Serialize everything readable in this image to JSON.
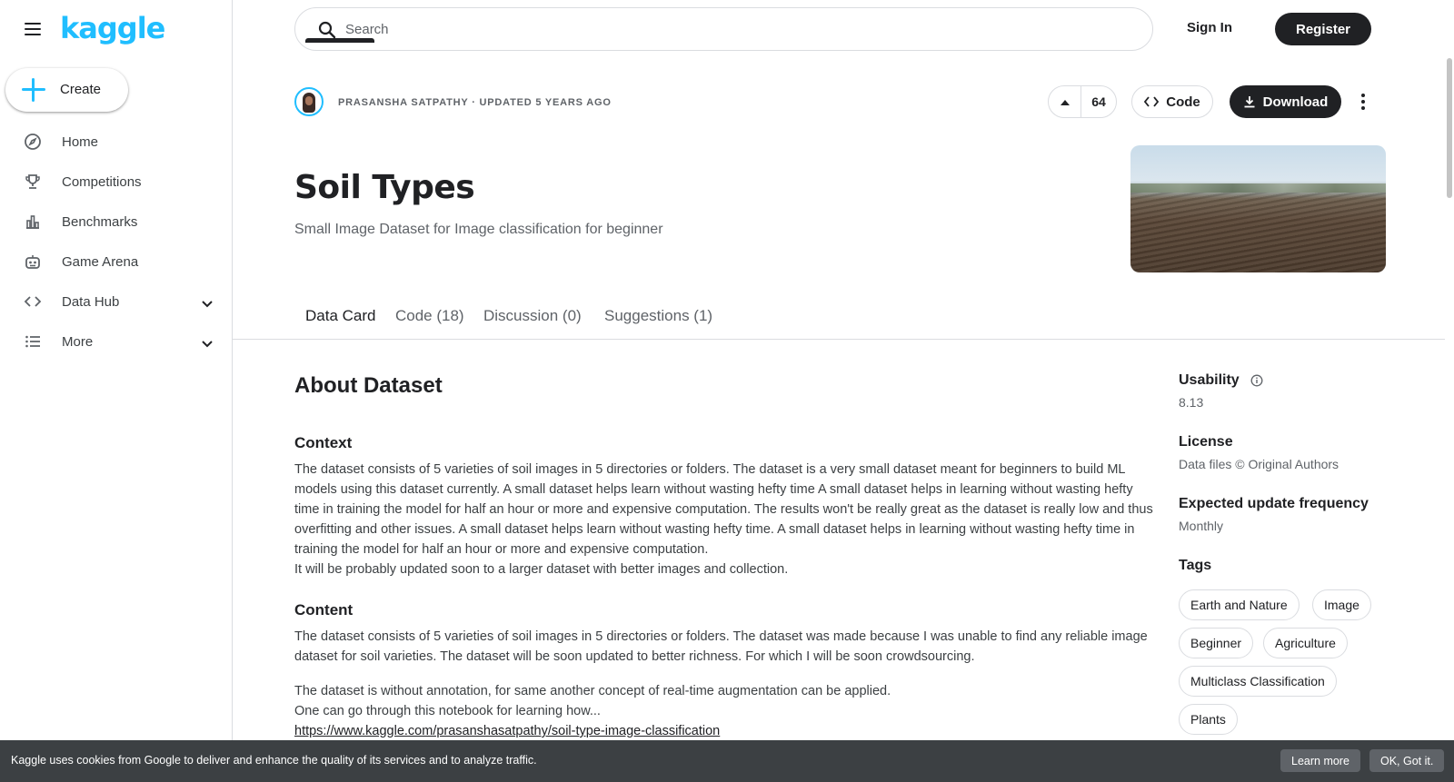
{
  "sidebar": {
    "logo": "kaggle",
    "create_label": "Create",
    "items": [
      {
        "label": "Home",
        "icon": "compass-icon"
      },
      {
        "label": "Competitions",
        "icon": "trophy-icon"
      },
      {
        "label": "Benchmarks",
        "icon": "bar-chart-icon"
      },
      {
        "label": "Game Arena",
        "icon": "robot-icon"
      },
      {
        "label": "Data Hub",
        "icon": "code-icon"
      },
      {
        "label": "More",
        "icon": "list-icon"
      }
    ]
  },
  "header": {
    "search_placeholder": "Search",
    "sign_in": "Sign In",
    "register": "Register"
  },
  "dataset": {
    "author_line": "PRASANSHA SATPATHY · UPDATED 5 YEARS AGO",
    "votes": "64",
    "code_label": "Code",
    "download_label": "Download",
    "title": "Soil Types",
    "subtitle": "Small Image Dataset for Image classification for beginner"
  },
  "tabs": [
    {
      "label": "Data Card"
    },
    {
      "label": "Code (18)"
    },
    {
      "label": "Discussion (0)"
    },
    {
      "label": "Suggestions (1)"
    }
  ],
  "content": {
    "about_heading": "About Dataset",
    "context_heading": "Context",
    "context_p1": "The dataset consists of 5 varieties of soil images in 5 directories or folders. The dataset is a very small dataset meant for beginners to build ML models using this dataset currently. A small dataset helps learn without wasting hefty time A small dataset helps in learning without wasting hefty time in training the model for half an hour or more and expensive computation. The results won't be really great as the dataset is really low and thus overfitting and other issues. A small dataset helps learn without wasting hefty time. A small dataset helps in learning without wasting hefty time in training the model for half an hour or more and expensive computation.",
    "context_p2": "It will be probably updated soon to a larger dataset with better images and collection.",
    "content_heading": "Content",
    "content_p1": "The dataset consists of 5 varieties of soil images in 5 directories or folders. The dataset was made because I was unable to find any reliable image dataset for soil varieties. The dataset will be soon updated to better richness. For which I will be soon crowdsourcing.",
    "content_p2": "The dataset is without annotation, for same another concept of real-time augmentation can be applied.",
    "content_p3": "One can go through this notebook for learning how...",
    "content_link": "https://www.kaggle.com/prasanshasatpathy/soil-type-image-classification"
  },
  "meta": {
    "usability_label": "Usability",
    "usability_value": "8.13",
    "license_label": "License",
    "license_value": "Data files © Original Authors",
    "frequency_label": "Expected update frequency",
    "frequency_value": "Monthly",
    "tags_label": "Tags",
    "tags": [
      "Earth and Nature",
      "Image",
      "Beginner",
      "Agriculture",
      "Multiclass Classification",
      "Plants"
    ]
  },
  "cookie": {
    "message": "Kaggle uses cookies from Google to deliver and enhance the quality of its services and to analyze traffic.",
    "learn_more": "Learn more",
    "ok": "OK, Got it."
  },
  "colors": {
    "brand": "#20beff",
    "dark": "#202124",
    "muted": "#5f6368"
  }
}
